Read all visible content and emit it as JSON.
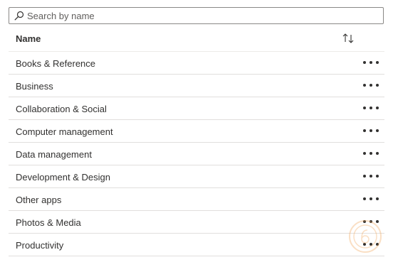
{
  "search": {
    "placeholder": "Search by name",
    "value": "",
    "icon": "search-icon"
  },
  "table": {
    "column_name": "Name",
    "sort_icon": "sort-arrows-icon",
    "more_icon": "more-horizontal-icon",
    "rows": [
      {
        "label": "Books & Reference"
      },
      {
        "label": "Business"
      },
      {
        "label": "Collaboration & Social"
      },
      {
        "label": "Computer management"
      },
      {
        "label": "Data management"
      },
      {
        "label": "Development & Design"
      },
      {
        "label": "Other apps"
      },
      {
        "label": "Photos & Media"
      },
      {
        "label": "Productivity"
      }
    ]
  },
  "colors": {
    "text": "#323130",
    "border": "#8a8886",
    "divider": "#e1dfdd",
    "watermark": "#f2a65a"
  }
}
